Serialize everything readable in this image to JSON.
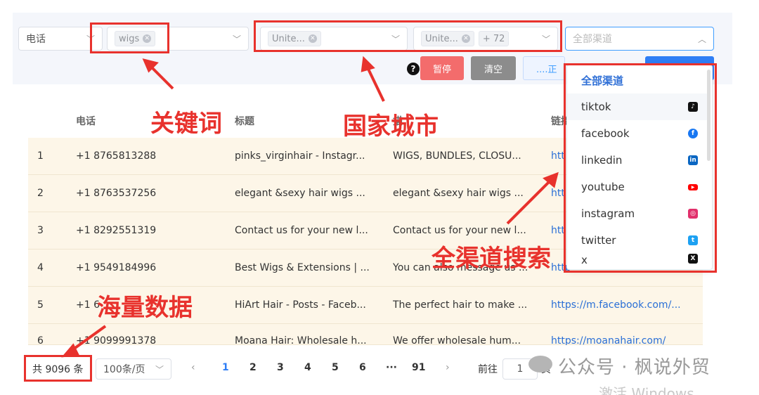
{
  "filters": {
    "phone_select": "电话",
    "keyword_tag": "wigs",
    "country_tag": "Unite...",
    "city_tag": "Unite...",
    "city_more": "+ 72",
    "channel_placeholder": "全部渠道"
  },
  "buttons": {
    "pause": "暂停",
    "clear": "清空",
    "loading": "....正"
  },
  "annotations": {
    "keyword": "关键词",
    "country_city": "国家城市",
    "all_channel": "全渠道搜索",
    "massive_data": "海量数据"
  },
  "table": {
    "headers": [
      "电话",
      "标题",
      "描",
      "链接"
    ],
    "rows": [
      {
        "idx": "1",
        "phone": "+1 8765813288",
        "title": "pinks_virginhair - Instagr...",
        "desc": "WIGS, BUNDLES, CLOSU...",
        "link": "htt"
      },
      {
        "idx": "2",
        "phone": "+1 8763537256",
        "title": "elegant &sexy hair wigs ...",
        "desc": "elegant &sexy hair wigs ...",
        "link": "htt"
      },
      {
        "idx": "3",
        "phone": "+1 8292551319",
        "title": "Contact us for your new l...",
        "desc": "Contact us for your new l...",
        "link": "htt"
      },
      {
        "idx": "4",
        "phone": "+1 9549184996",
        "title": "Best Wigs & Extensions | ...",
        "desc": "You can also message us ...",
        "link": "http"
      },
      {
        "idx": "5",
        "phone": "+1 6",
        "title": "HiArt Hair - Posts - Faceb...",
        "desc": "The perfect hair to make ...",
        "link": "https://m.facebook.com/..."
      },
      {
        "idx": "6",
        "phone": "+1 9099991378",
        "title": "Moana Hair: Wholesale h...",
        "desc": "We offer wholesale hum...",
        "link": "https://moanahair.com/"
      }
    ]
  },
  "channel_dropdown": {
    "header": "全部渠道",
    "items": [
      {
        "label": "tiktok",
        "icon": "tiktok-icon",
        "color": "#111111"
      },
      {
        "label": "facebook",
        "icon": "facebook-icon",
        "color": "#1877f2"
      },
      {
        "label": "linkedin",
        "icon": "linkedin-icon",
        "color": "#0a66c2"
      },
      {
        "label": "youtube",
        "icon": "youtube-icon",
        "color": "#ff0000"
      },
      {
        "label": "instagram",
        "icon": "instagram-icon",
        "color": "#e1306c"
      },
      {
        "label": "twitter",
        "icon": "twitter-icon",
        "color": "#1da1f2"
      },
      {
        "label": "x",
        "icon": "x-icon",
        "color": "#111111"
      }
    ]
  },
  "pagination": {
    "total": "共 9096 条",
    "page_size": "100条/页",
    "pages": [
      "1",
      "2",
      "3",
      "4",
      "5",
      "6"
    ],
    "ellipsis": "···",
    "last": "91",
    "goto_label": "前往",
    "goto_value": "1",
    "page_suffix": "页"
  },
  "watermark": {
    "account": "公众号 · 枫说外贸",
    "activate": "激活 Windows"
  }
}
